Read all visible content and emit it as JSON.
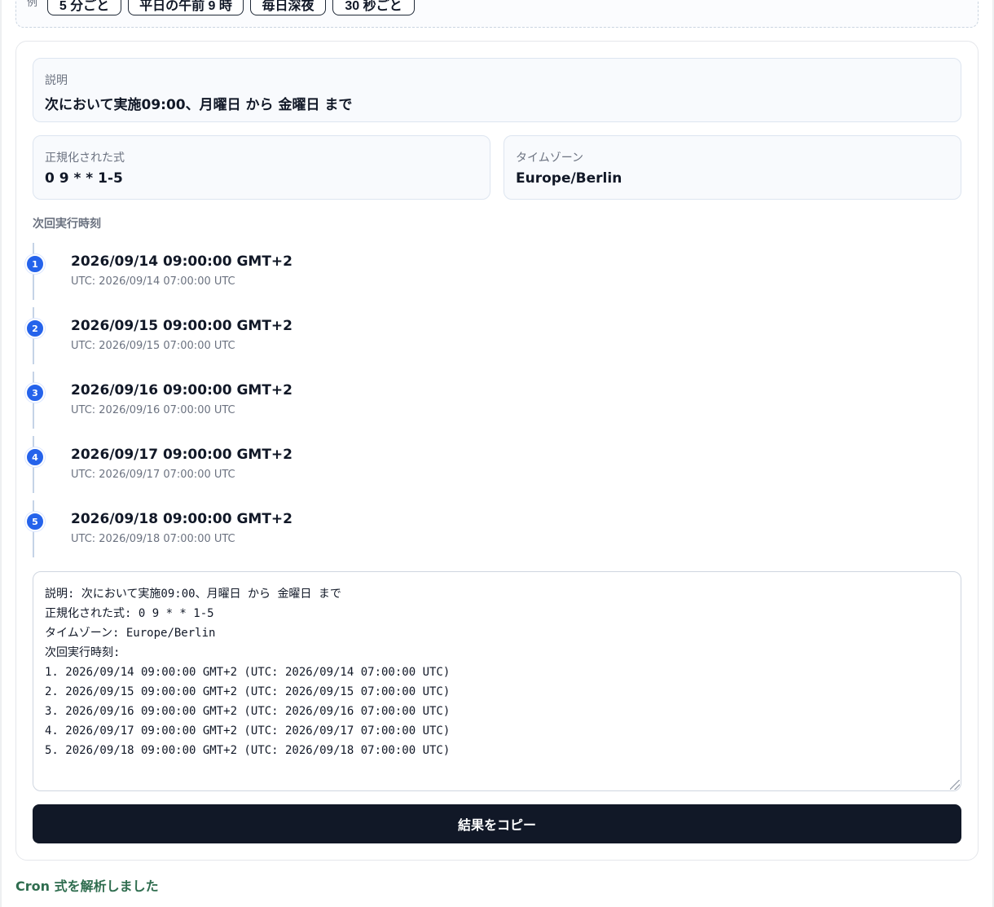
{
  "presets": {
    "label": "例",
    "items": [
      "5 分ごと",
      "平日の午前 9 時",
      "毎日深夜",
      "30 秒ごと"
    ]
  },
  "description": {
    "label": "説明",
    "value": "次において実施09:00、月曜日 から 金曜日 まで"
  },
  "normalized": {
    "label": "正規化された式",
    "value": "0 9 * * 1-5"
  },
  "timezone": {
    "label": "タイムゾーン",
    "value": "Europe/Berlin"
  },
  "next_runs": {
    "title": "次回実行時刻",
    "items": [
      {
        "index": "1",
        "local": "2026/09/14 09:00:00 GMT+2",
        "utc": "UTC: 2026/09/14 07:00:00 UTC"
      },
      {
        "index": "2",
        "local": "2026/09/15 09:00:00 GMT+2",
        "utc": "UTC: 2026/09/15 07:00:00 UTC"
      },
      {
        "index": "3",
        "local": "2026/09/16 09:00:00 GMT+2",
        "utc": "UTC: 2026/09/16 07:00:00 UTC"
      },
      {
        "index": "4",
        "local": "2026/09/17 09:00:00 GMT+2",
        "utc": "UTC: 2026/09/17 07:00:00 UTC"
      },
      {
        "index": "5",
        "local": "2026/09/18 09:00:00 GMT+2",
        "utc": "UTC: 2026/09/18 07:00:00 UTC"
      }
    ]
  },
  "output_text": "説明: 次において実施09:00、月曜日 から 金曜日 まで\n正規化された式: 0 9 * * 1-5\nタイムゾーン: Europe/Berlin\n次回実行時刻:\n1. 2026/09/14 09:00:00 GMT+2 (UTC: 2026/09/14 07:00:00 UTC)\n2. 2026/09/15 09:00:00 GMT+2 (UTC: 2026/09/15 07:00:00 UTC)\n3. 2026/09/16 09:00:00 GMT+2 (UTC: 2026/09/16 07:00:00 UTC)\n4. 2026/09/17 09:00:00 GMT+2 (UTC: 2026/09/17 07:00:00 UTC)\n5. 2026/09/18 09:00:00 GMT+2 (UTC: 2026/09/18 07:00:00 UTC)",
  "copy_button_label": "結果をコピー",
  "status_message": "Cron 式を解析しました",
  "colors": {
    "accent": "#2563eb",
    "button_bg": "#111827",
    "status": "#2f6d4f"
  }
}
